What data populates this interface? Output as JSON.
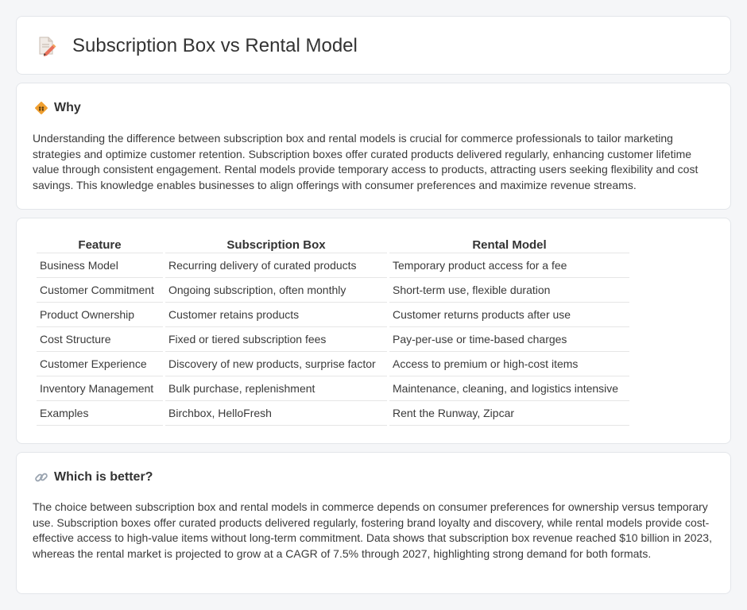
{
  "header": {
    "title": "Subscription Box vs Rental Model",
    "icon": "document-pencil-icon"
  },
  "why": {
    "icon": "diamond-icon",
    "title": "Why",
    "text": "Understanding the difference between subscription box and rental models is crucial for commerce professionals to tailor marketing strategies and optimize customer retention. Subscription boxes offer curated products delivered regularly, enhancing customer lifetime value through consistent engagement. Rental models provide temporary access to products, attracting users seeking flexibility and cost savings. This knowledge enables businesses to align offerings with consumer preferences and maximize revenue streams."
  },
  "table": {
    "headers": [
      "Feature",
      "Subscription Box",
      "Rental Model"
    ],
    "rows": [
      [
        "Business Model",
        "Recurring delivery of curated products",
        "Temporary product access for a fee"
      ],
      [
        "Customer Commitment",
        "Ongoing subscription, often monthly",
        "Short-term use, flexible duration"
      ],
      [
        "Product Ownership",
        "Customer retains products",
        "Customer returns products after use"
      ],
      [
        "Cost Structure",
        "Fixed or tiered subscription fees",
        "Pay-per-use or time-based charges"
      ],
      [
        "Customer Experience",
        "Discovery of new products, surprise factor",
        "Access to premium or high-cost items"
      ],
      [
        "Inventory Management",
        "Bulk purchase, replenishment",
        "Maintenance, cleaning, and logistics intensive"
      ],
      [
        "Examples",
        "Birchbox, HelloFresh",
        "Rent the Runway, Zipcar"
      ]
    ]
  },
  "better": {
    "icon": "link-icon",
    "title": "Which is better?",
    "text": "The choice between subscription box and rental models in commerce depends on consumer preferences for ownership versus temporary use. Subscription boxes offer curated products delivered regularly, fostering brand loyalty and discovery, while rental models provide cost-effective access to high-value items without long-term commitment. Data shows that subscription box revenue reached $10 billion in 2023, whereas the rental market is projected to grow at a CAGR of 7.5% through 2027, highlighting strong demand for both formats."
  },
  "colors": {
    "background": "#f5f6f8",
    "card": "#ffffff",
    "border": "#e3e6ea",
    "accent_orange": "#f0a030",
    "icon_pink": "#e07070"
  }
}
